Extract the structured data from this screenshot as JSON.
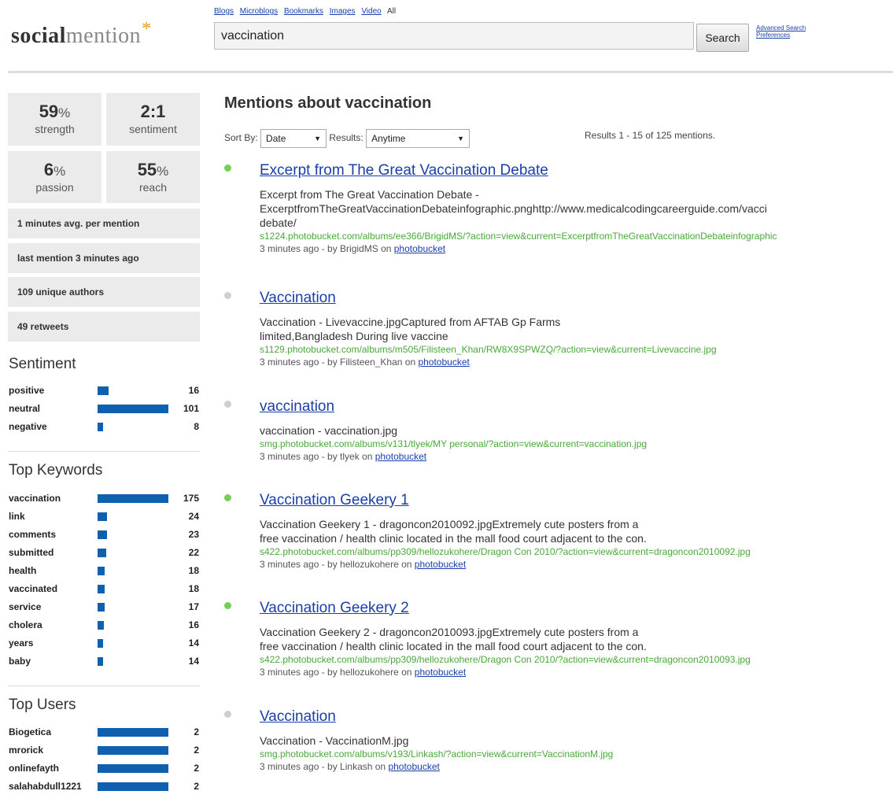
{
  "logo": {
    "part1": "social",
    "part2": "mention",
    "star": "*"
  },
  "type_links": [
    "Blogs",
    "Microblogs",
    "Bookmarks",
    "Images",
    "Video"
  ],
  "type_active": "All",
  "search": {
    "value": "vaccination",
    "button": "Search"
  },
  "adv_links": [
    "Advanced Search",
    "Preferences"
  ],
  "stats": [
    {
      "value": "59",
      "unit": "%",
      "label": "strength"
    },
    {
      "value": "2:1",
      "unit": "",
      "label": "sentiment"
    },
    {
      "value": "6",
      "unit": "%",
      "label": "passion"
    },
    {
      "value": "55",
      "unit": "%",
      "label": "reach"
    }
  ],
  "info_rows": [
    "1 minutes avg. per mention",
    "last mention 3 minutes ago",
    "109 unique authors",
    "49 retweets"
  ],
  "sentiment": {
    "title": "Sentiment",
    "items": [
      {
        "name": "positive",
        "count": 16
      },
      {
        "name": "neutral",
        "count": 101
      },
      {
        "name": "negative",
        "count": 8
      }
    ]
  },
  "keywords": {
    "title": "Top Keywords",
    "items": [
      {
        "name": "vaccination",
        "count": 175
      },
      {
        "name": "link",
        "count": 24
      },
      {
        "name": "comments",
        "count": 23
      },
      {
        "name": "submitted",
        "count": 22
      },
      {
        "name": "health",
        "count": 18
      },
      {
        "name": "vaccinated",
        "count": 18
      },
      {
        "name": "service",
        "count": 17
      },
      {
        "name": "cholera",
        "count": 16
      },
      {
        "name": "years",
        "count": 14
      },
      {
        "name": "baby",
        "count": 14
      }
    ]
  },
  "users": {
    "title": "Top Users",
    "items": [
      {
        "name": "Biogetica",
        "count": 2
      },
      {
        "name": "mrorick",
        "count": 2
      },
      {
        "name": "onlinefayth",
        "count": 2
      },
      {
        "name": "salahabdull1221",
        "count": 2
      }
    ]
  },
  "main": {
    "title": "Mentions about vaccination",
    "sort_label": "Sort By:",
    "sort_value": "Date",
    "results_label": "Results:",
    "results_value": "Anytime",
    "results_count": "Results 1 - 15 of 125 mentions."
  },
  "results": [
    {
      "status": "green",
      "title": "Excerpt from The Great Vaccination Debate",
      "desc": [
        "Excerpt from The Great Vaccination Debate -",
        "ExcerptfromTheGreatVaccinationDebateinfographic.pnghttp://www.medicalcodingcareerguide.com/vacci",
        "debate/"
      ],
      "source": "s1224.photobucket.com/albums/ee366/BrigidMS/?action=view&current=ExcerptfromTheGreatVaccinationDebateinfographic",
      "meta_prefix": "3 minutes ago - by BrigidMS on ",
      "meta_link": "photobucket"
    },
    {
      "status": "gray",
      "title": "Vaccination",
      "desc": [
        "Vaccination - Livevaccine.jpgCaptured from AFTAB Gp Farms",
        "limited,Bangladesh During live vaccine"
      ],
      "source": "s1129.photobucket.com/albums/m505/Filisteen_Khan/RW8X9SPWZQ/?action=view&current=Livevaccine.jpg",
      "meta_prefix": "3 minutes ago - by Filisteen_Khan on ",
      "meta_link": "photobucket"
    },
    {
      "status": "gray",
      "title": "vaccination",
      "desc": [
        "vaccination - vaccination.jpg"
      ],
      "source": "smg.photobucket.com/albums/v131/tlyek/MY personal/?action=view&current=vaccination.jpg",
      "meta_prefix": "3 minutes ago - by tlyek on ",
      "meta_link": "photobucket"
    },
    {
      "status": "green",
      "title": "Vaccination Geekery 1",
      "desc": [
        "Vaccination Geekery 1 - dragoncon2010092.jpgExtremely cute posters from a",
        "free vaccination / health clinic located in the mall food court adjacent to the con."
      ],
      "source": "s422.photobucket.com/albums/pp309/hellozukohere/Dragon Con 2010/?action=view&current=dragoncon2010092.jpg",
      "meta_prefix": "3 minutes ago - by hellozukohere on ",
      "meta_link": "photobucket"
    },
    {
      "status": "green",
      "title": "Vaccination Geekery 2",
      "desc": [
        "Vaccination Geekery 2 - dragoncon2010093.jpgExtremely cute posters from a",
        "free vaccination / health clinic located in the mall food court adjacent to the con."
      ],
      "source": "s422.photobucket.com/albums/pp309/hellozukohere/Dragon Con 2010/?action=view&current=dragoncon2010093.jpg",
      "meta_prefix": "3 minutes ago - by hellozukohere on ",
      "meta_link": "photobucket"
    },
    {
      "status": "gray",
      "title": "Vaccination",
      "desc": [
        "Vaccination - VaccinationM.jpg"
      ],
      "source": "smg.photobucket.com/albums/v193/Linkash/?action=view&current=VaccinationM.jpg",
      "meta_prefix": "3 minutes ago - by Linkash on ",
      "meta_link": "photobucket"
    }
  ]
}
